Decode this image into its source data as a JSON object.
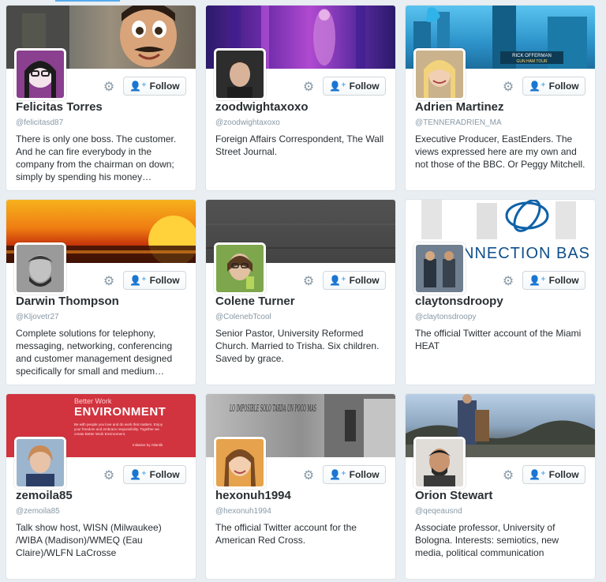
{
  "follow_label": "Follow",
  "cards": [
    {
      "name": "Felicitas Torres",
      "handle": "@felicitasd87",
      "bio": "There is only one boss. The customer. And he can fire everybody in the company from the chairman on down; simply by spending his money…"
    },
    {
      "name": "zoodwightaxoxo",
      "handle": "@zoodwightaxoxo",
      "bio": "Foreign Affairs Correspondent, The Wall Street Journal."
    },
    {
      "name": "Adrien Martinez",
      "handle": "@TENNERADRIEN_MA",
      "bio": "Executive Producer, EastEnders. The views expressed here are my own and not those of the BBC. Or Peggy Mitchell."
    },
    {
      "name": "Darwin Thompson",
      "handle": "@Kljovetr27",
      "bio": "Complete solutions for telephony, messaging, networking, conferencing and customer management designed specifically for small and medium…"
    },
    {
      "name": "Colene Turner",
      "handle": "@ColenebTcool",
      "bio": "Senior Pastor, University Reformed Church. Married to Trisha. Six children. Saved by grace."
    },
    {
      "name": "claytonsdroopy",
      "handle": "@claytonsdroopy",
      "bio": "The official Twitter account of the Miami HEAT"
    },
    {
      "name": "zemoila85",
      "handle": "@zemoila85",
      "bio": "Talk show host, WISN (Milwaukee) /WIBA (Madison)/WMEQ (Eau Claire)/WLFN LaCrosse"
    },
    {
      "name": "hexonuh1994",
      "handle": "@hexonuh1994",
      "bio": "The official Twitter account for the American Red Cross."
    },
    {
      "name": "Orion Stewart",
      "handle": "@qeqeausnd",
      "bio": "Associate professor, University of Bologna. Interests: semiotics, new media, political communication"
    }
  ],
  "banner_text": {
    "marquee": "RICK OFFERMAN",
    "marquee_sub": "GUN HAM TOUR",
    "connection": "NNECTION BAS",
    "environment_kicker": "Better Work",
    "environment_title": "ENVIRONMENT",
    "environment_sub": "Be with people you love and do work that matters. Enjoy your freedom and embrace responsibility. Together we create Better Work Environment.",
    "environment_credit": "Initiative by Atlantik",
    "graffiti": "LO IMPOSIBLE SOLO TARDA UN POCO MAS"
  },
  "colors": {
    "accent": "#55acee",
    "text": "#292f33",
    "muted": "#8899a6"
  }
}
